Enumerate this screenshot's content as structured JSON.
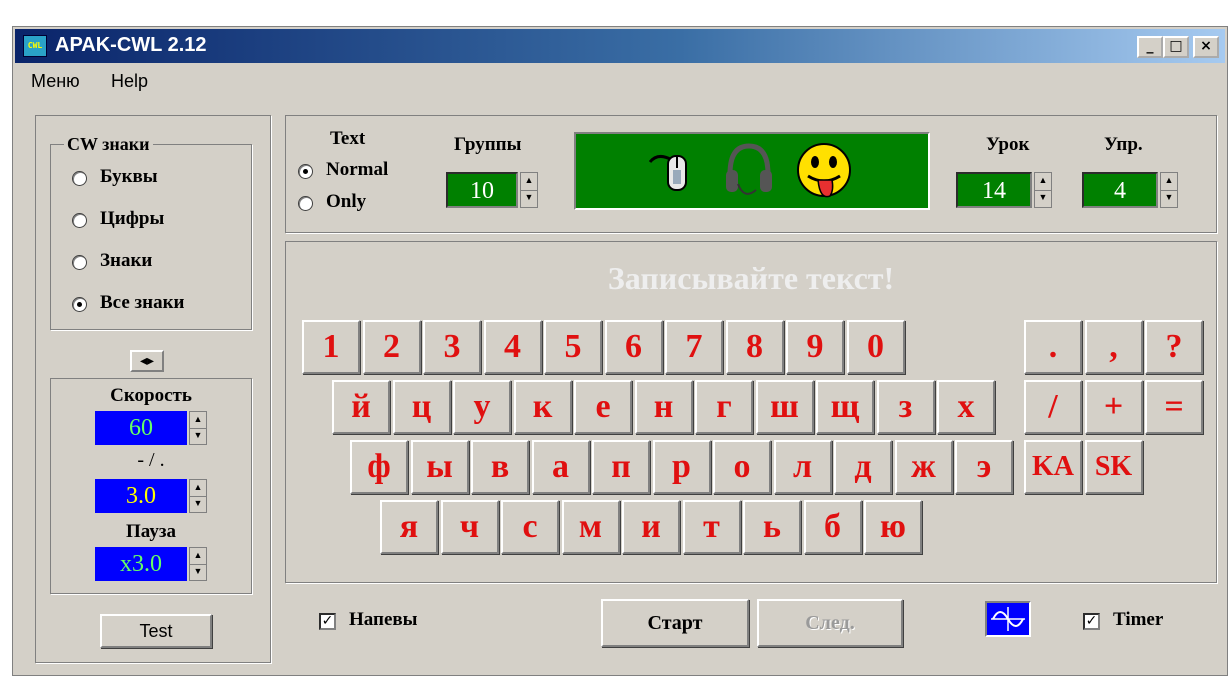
{
  "window": {
    "title": "APAK-CWL 2.12",
    "icon_label": "CWL",
    "controls": {
      "minimize": "_",
      "maximize": "□",
      "close": "×"
    }
  },
  "menu": [
    {
      "label": "Меню"
    },
    {
      "label": "Help"
    }
  ],
  "cw_signs": {
    "title": "CW знаки",
    "options": [
      {
        "label": "Буквы",
        "selected": false
      },
      {
        "label": "Цифры",
        "selected": false
      },
      {
        "label": "Знаки",
        "selected": false
      },
      {
        "label": "Все знаки",
        "selected": true
      }
    ]
  },
  "swap_arrows": "◂▸",
  "speed": {
    "label": "Скорость",
    "value": "60",
    "value_color": "#66ff66"
  },
  "ratio": {
    "label": "- / .",
    "value": "3.0",
    "value_color": "#ffff00"
  },
  "pause": {
    "label": "Пауза",
    "value": "x3.0",
    "value_color": "#66ff66"
  },
  "test_button": "Test",
  "text_mode": {
    "label": "Text",
    "options": [
      {
        "label": "Normal",
        "selected": true
      },
      {
        "label": "Only",
        "selected": false
      }
    ]
  },
  "groups": {
    "label": "Группы",
    "value": "10"
  },
  "lesson": {
    "label": "Урок",
    "value": "14"
  },
  "exercise": {
    "label": "Упр.",
    "value": "4"
  },
  "status_icons": [
    "mouse-icon",
    "headphones-icon",
    "smiley-tongue-icon"
  ],
  "prompt": "Записывайте текст!",
  "keyboard": {
    "rows": [
      [
        "1",
        "2",
        "3",
        "4",
        "5",
        "6",
        "7",
        "8",
        "9",
        "0"
      ],
      [
        "й",
        "ц",
        "у",
        "к",
        "е",
        "н",
        "г",
        "ш",
        "щ",
        "з",
        "х"
      ],
      [
        "ф",
        "ы",
        "в",
        "а",
        "п",
        "р",
        "о",
        "л",
        "д",
        "ж",
        "э"
      ],
      [
        "я",
        "ч",
        "с",
        "м",
        "и",
        "т",
        "ь",
        "б",
        "ю"
      ]
    ],
    "punct_rows": [
      [
        ".",
        ",",
        "?"
      ],
      [
        "/",
        "+",
        "="
      ],
      [
        "KA",
        "SK"
      ]
    ]
  },
  "bottom": {
    "hints_checkbox": {
      "label": "Напевы",
      "checked": true,
      "mark": "✓"
    },
    "start_button": "Старт",
    "next_button": "След.",
    "timer_checkbox": {
      "label": "Timer",
      "checked": true,
      "mark": "✓"
    }
  },
  "colors": {
    "display_bg": "#0000ff",
    "spin_bg": "#008000",
    "key_text": "#e01010",
    "status_panel": "#008000"
  }
}
